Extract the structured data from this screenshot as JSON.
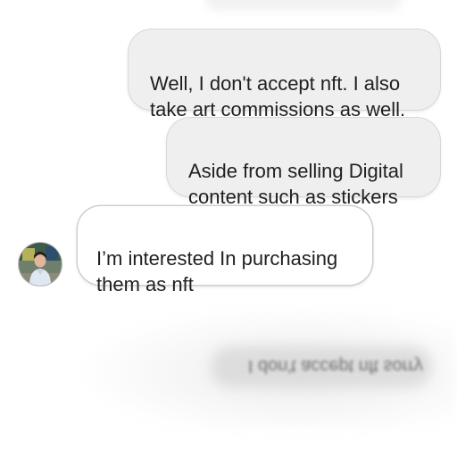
{
  "messages": [
    {
      "direction": "sent",
      "text": "Well, I don't accept nft. I also\ntake art commissions as well."
    },
    {
      "direction": "sent",
      "text": "Aside from selling Digital\ncontent such as stickers"
    },
    {
      "direction": "received",
      "text": "I’m interested In purchasing\nthem as nft"
    }
  ],
  "reflection": {
    "text": "I don't accept nft sorry"
  },
  "colors": {
    "sent_bubble_bg": "#efefef",
    "received_bubble_bg": "#ffffff",
    "text": "#1f1f1f",
    "background": "#ffffff"
  },
  "icons": {
    "avatar": "contact-avatar-photo"
  }
}
